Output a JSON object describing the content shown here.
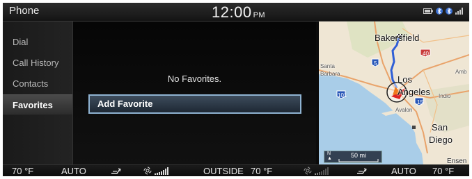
{
  "status_bar": {
    "app_title": "Phone",
    "clock": "12:00",
    "ampm": "PM",
    "icons": [
      "battery-icon",
      "bluetooth-icon",
      "bluetooth-icon",
      "signal-icon"
    ]
  },
  "sidebar": {
    "items": [
      {
        "label": "Dial"
      },
      {
        "label": "Call History"
      },
      {
        "label": "Contacts"
      },
      {
        "label": "Favorites"
      }
    ],
    "active_index": 3
  },
  "main": {
    "empty_message": "No Favorites.",
    "add_button_label": "Add Favorite"
  },
  "map": {
    "labels": {
      "bakersfield": "Bakersfield",
      "santa": "Santa",
      "barbara": "Barbara",
      "amb": "Amb",
      "los": "Los",
      "angeles": "Angeles",
      "indio": "Indio",
      "avalon": "Avalon",
      "san": "San",
      "diego": "Diego",
      "ensen": "Ensen"
    },
    "highway_shields": [
      "5",
      "40",
      "101",
      "15"
    ],
    "scale_north": "N",
    "scale": "50 mi"
  },
  "climate": {
    "left_temp": "70 °F",
    "left_mode": "AUTO",
    "outside_label": "OUTSIDE",
    "outside_temp": "70 °F",
    "right_mode": "AUTO",
    "right_temp": "70 °F"
  },
  "colors": {
    "accent": "#8fb3d2",
    "route": "#2f5fd6",
    "ocean": "#a9cde8",
    "land": "#efe6d4"
  }
}
